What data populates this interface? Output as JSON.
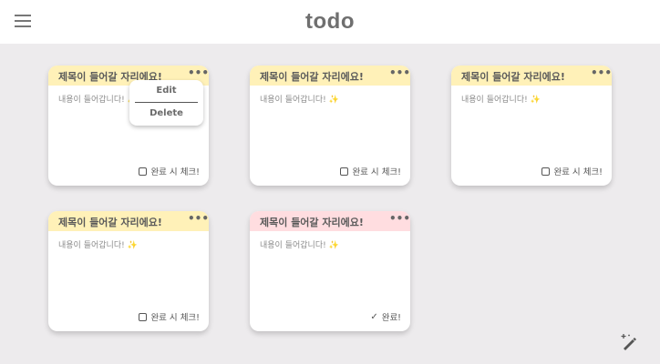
{
  "app": {
    "title": "todo"
  },
  "colors": {
    "background": "#edebed",
    "card_header_pending": "#fff1b8",
    "card_header_done": "#ffdde0"
  },
  "cards": [
    {
      "title": "제목이 들어갈 자리에요!",
      "content": "내용이 들어갑니다!",
      "sparkle": "✨",
      "status": "pending",
      "status_label": "완료 시 체크!",
      "menu_open": true
    },
    {
      "title": "제목이 들어갈 자리에요!",
      "content": "내용이 들어갑니다!",
      "sparkle": "✨",
      "status": "pending",
      "status_label": "완료 시 체크!",
      "menu_open": false
    },
    {
      "title": "제목이 들어갈 자리에요!",
      "content": "내용이 들어갑니다!",
      "sparkle": "✨",
      "status": "pending",
      "status_label": "완료 시 체크!",
      "menu_open": false
    },
    {
      "title": "제목이 들어갈 자리에요!",
      "content": "내용이 들어갑니다!",
      "sparkle": "✨",
      "status": "pending",
      "status_label": "완료 시 체크!",
      "menu_open": false
    },
    {
      "title": "제목이 들어갈 자리에요!",
      "content": "내용이 들어갑니다!",
      "sparkle": "✨",
      "status": "done",
      "status_label": "완료!",
      "menu_open": false
    }
  ],
  "card_menu": {
    "edit_label": "Edit",
    "delete_label": "Delete"
  },
  "icons": {
    "menu": "hamburger-menu-icon",
    "more": "more-horizontal-icon",
    "sparkle": "sparkle-icon",
    "checkbox": "checkbox-icon",
    "check": "check-icon",
    "add": "magic-wand-add-icon"
  }
}
